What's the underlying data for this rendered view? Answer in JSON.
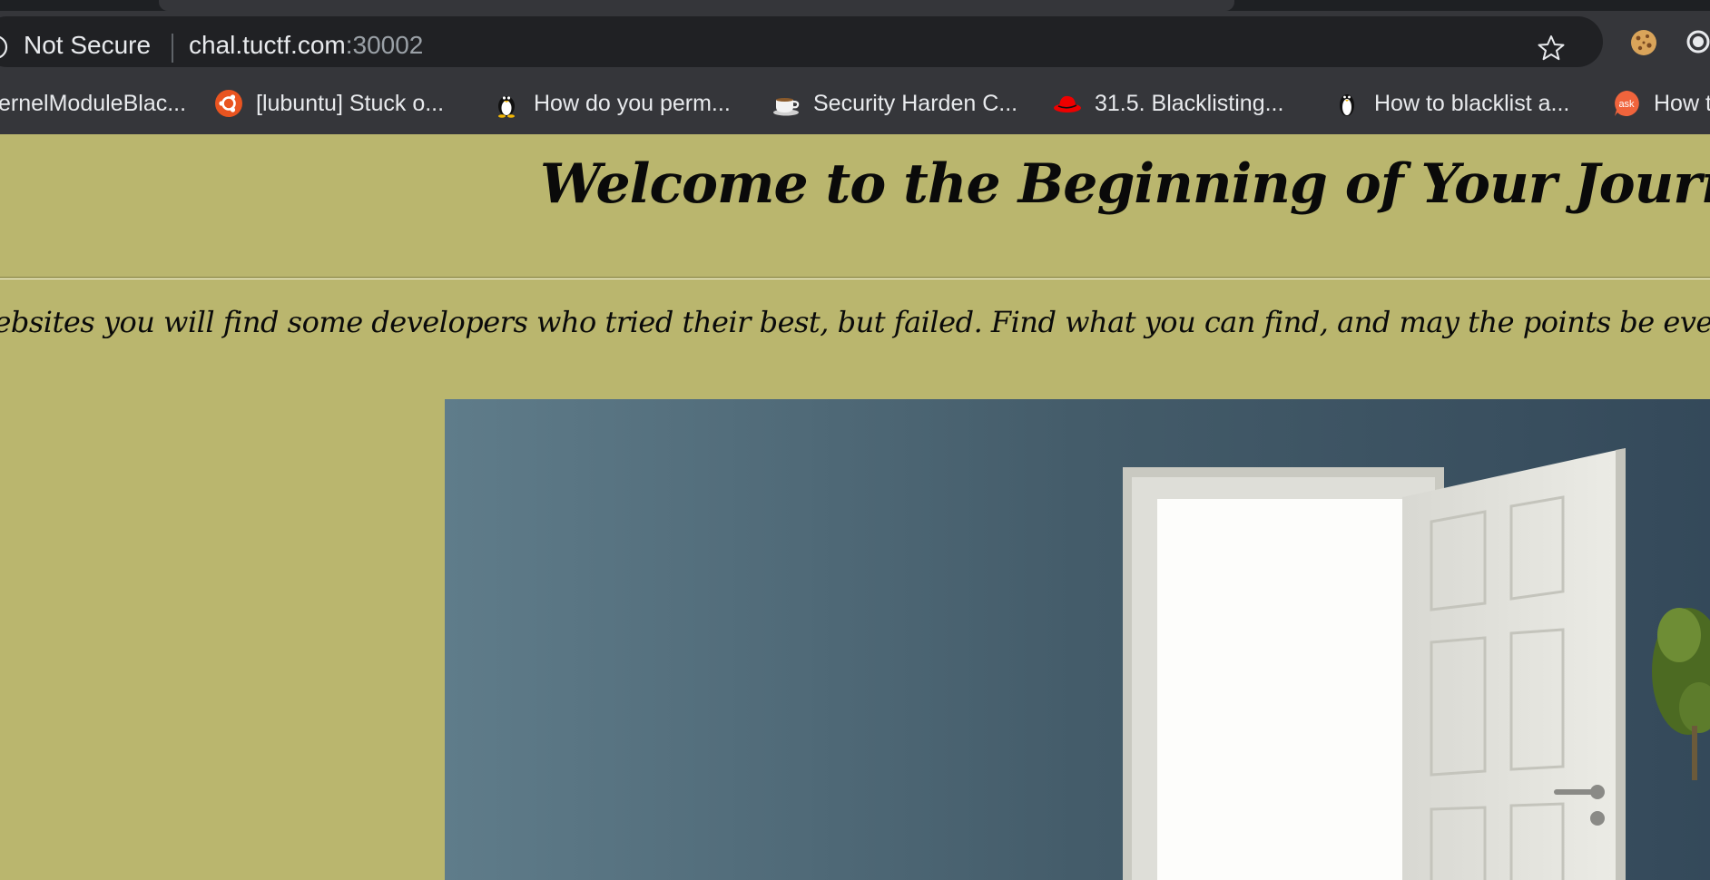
{
  "browser": {
    "security_label": "Not Secure",
    "url_host": "chal.tuctf.com",
    "url_port": ":30002",
    "bookmarks": [
      {
        "label": "ernelModuleBlac...",
        "icon": "none"
      },
      {
        "label": "[lubuntu] Stuck o...",
        "icon": "ubuntu-icon"
      },
      {
        "label": "How do you perm...",
        "icon": "tux-icon"
      },
      {
        "label": "Security Harden C...",
        "icon": "coffee-cup-icon"
      },
      {
        "label": "31.5. Blacklisting...",
        "icon": "redhat-icon"
      },
      {
        "label": "How to blacklist a...",
        "icon": "penguin-icon"
      },
      {
        "label": "How t",
        "icon": "ask-icon"
      }
    ]
  },
  "page": {
    "title": "Welcome to the Beginning of Your Journey",
    "intro": "w websites you will find some developers who tried their best, but failed. Find what you can find, and may the points be ever in your fav",
    "hero_image": "open-door-image",
    "colors": {
      "background": "#bab66e",
      "wall": "#3f5866",
      "door": "#e4e4de"
    }
  }
}
